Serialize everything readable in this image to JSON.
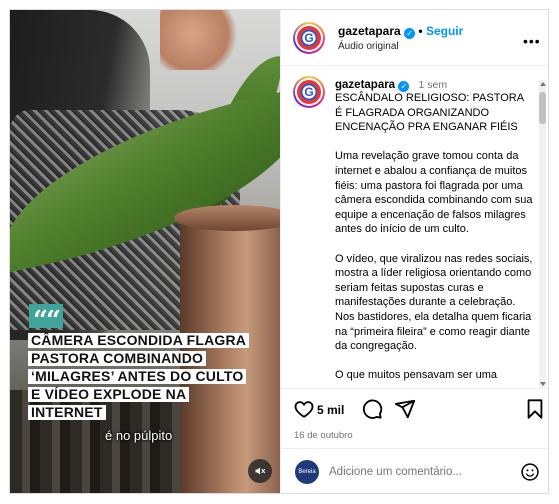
{
  "post": {
    "username": "gazetapara",
    "follow_label": "Seguir",
    "audio": "Áudio original",
    "more_label": "•••"
  },
  "media": {
    "quote_mark": "““",
    "headline_lines": [
      "CÂMERA ESCONDIDA FLAGRA",
      "PASTORA COMBINANDO",
      "‘MILAGRES’ ANTES DO CULTO",
      "E VÍDEO EXPLODE NA",
      "INTERNET"
    ],
    "subtitle": "é no púlpito",
    "icons": {
      "mute": "speaker-muted-icon"
    }
  },
  "caption": {
    "username": "gazetapara",
    "time": "1 sem",
    "text": "ESCÂNDALO RELIGIOSO: PASTORA É FLAGRADA ORGANIZANDO ENCENAÇÃO PRA ENGANAR FIÉIS\n\nUma revelação grave tomou conta da internet e abalou a confiança de muitos fiéis: uma pastora foi flagrada por uma câmera escondida combinando com sua equipe a encenação de falsos milagres antes do início de um culto.\n\nO vídeo, que viralizou nas redes sociais, mostra a líder religiosa orientando como seriam feitas supostas curas e manifestações durante a celebração. Nos bastidores, ela detalha quem ficaria na “primeira fileira” e como reagir diante da congregação.\n\nO que muitos pensavam ser uma"
  },
  "actions": {
    "likes": "5 mil",
    "date": "16 de outubro",
    "icons": [
      "heart-icon",
      "comment-icon",
      "share-icon",
      "bookmark-icon"
    ]
  },
  "comment_box": {
    "placeholder": "Adicione um comentário...",
    "avatar_text": "Bereia"
  },
  "colors": {
    "accent": "#0095f6",
    "badge": "#3fa59b",
    "muted_text": "#737373"
  }
}
